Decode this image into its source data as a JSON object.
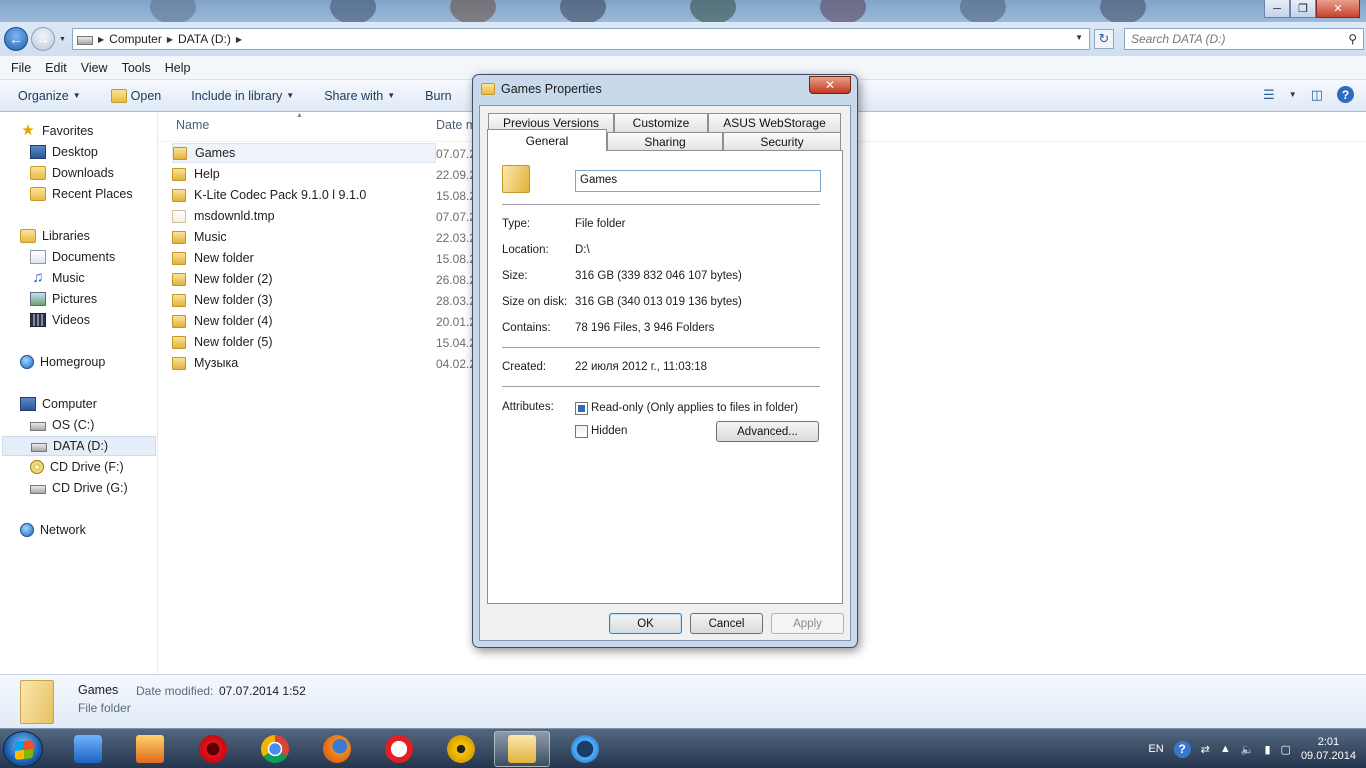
{
  "explorer": {
    "breadcrumb": [
      "Computer",
      "DATA (D:)"
    ],
    "search_placeholder": "Search DATA (D:)",
    "menu": [
      "File",
      "Edit",
      "View",
      "Tools",
      "Help"
    ],
    "commands": {
      "organize": "Organize",
      "open": "Open",
      "include": "Include in library",
      "share": "Share with",
      "burn": "Burn"
    },
    "nav": {
      "favorites": "Favorites",
      "desktop": "Desktop",
      "downloads": "Downloads",
      "recent": "Recent Places",
      "libraries": "Libraries",
      "documents": "Documents",
      "music": "Music",
      "pictures": "Pictures",
      "videos": "Videos",
      "homegroup": "Homegroup",
      "computer": "Computer",
      "os_c": "OS (C:)",
      "data_d": "DATA (D:)",
      "cd_f": "CD Drive (F:)",
      "cd_g": "CD Drive (G:)",
      "network": "Network"
    },
    "columns": {
      "name": "Name",
      "date": "Date m"
    },
    "files": [
      {
        "name": "Games",
        "date": "07.07.2"
      },
      {
        "name": "Help",
        "date": "22.09.2"
      },
      {
        "name": "K-Lite Codec Pack 9.1.0 l 9.1.0",
        "date": "15.08.2"
      },
      {
        "name": "msdownld.tmp",
        "date": "07.07.2"
      },
      {
        "name": "Music",
        "date": "22.03.2"
      },
      {
        "name": "New folder",
        "date": "15.08.2"
      },
      {
        "name": "New folder (2)",
        "date": "26.08.2"
      },
      {
        "name": "New folder (3)",
        "date": "28.03.2"
      },
      {
        "name": "New folder (4)",
        "date": "20.01.2"
      },
      {
        "name": "New folder (5)",
        "date": "15.04.2"
      },
      {
        "name": "Музыка",
        "date": "04.02.2"
      }
    ],
    "details": {
      "name": "Games",
      "modified_label": "Date modified:",
      "modified_value": "07.07.2014 1:52",
      "type": "File folder"
    }
  },
  "dialog": {
    "title": "Games Properties",
    "tabs": {
      "previous_versions": "Previous Versions",
      "customize": "Customize",
      "asus": "ASUS WebStorage",
      "general": "General",
      "sharing": "Sharing",
      "security": "Security"
    },
    "folder_name": "Games",
    "type_label": "Type:",
    "type_value": "File folder",
    "location_label": "Location:",
    "location_value": "D:\\",
    "size_label": "Size:",
    "size_value": "316 GB (339 832 046 107 bytes)",
    "size_on_disk_label": "Size on disk:",
    "size_on_disk_value": "316 GB (340 013 019 136 bytes)",
    "contains_label": "Contains:",
    "contains_value": "78 196 Files, 3 946 Folders",
    "created_label": "Created:",
    "created_value": "22 июля 2012 г., 11:03:18",
    "attributes_label": "Attributes:",
    "readonly_label": "Read-only (Only applies to files in folder)",
    "hidden_label": "Hidden",
    "advanced_label": "Advanced...",
    "ok_label": "OK",
    "cancel_label": "Cancel",
    "apply_label": "Apply"
  },
  "taskbar": {
    "lang": "EN",
    "time": "2:01",
    "date": "09.07.2014"
  }
}
